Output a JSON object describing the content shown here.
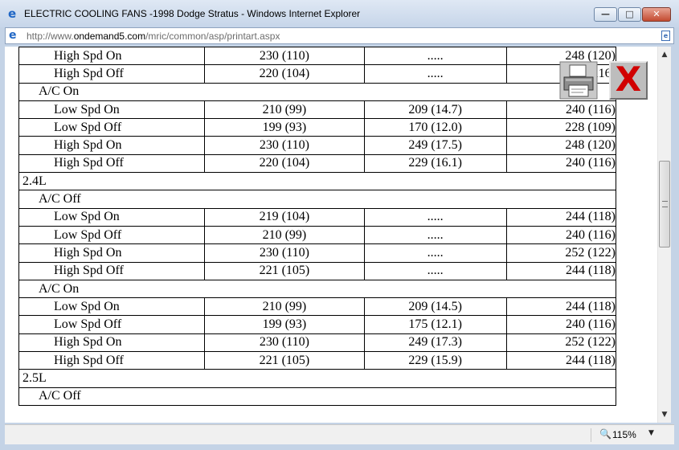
{
  "window": {
    "title": "ELECTRIC COOLING FANS -1998 Dodge Stratus - Windows Internet Explorer",
    "min_glyph": "—",
    "max_glyph": "□",
    "close_glyph": "✕"
  },
  "address": {
    "prefix": "http://www.",
    "domain": "ondemand5.com",
    "path": "/mric/common/asp/printart.aspx"
  },
  "overlay": {
    "close_glyph": "X"
  },
  "table": {
    "rows": [
      {
        "type": "data",
        "label": "High Spd On",
        "c2": "230 (110)",
        "c3": ".....",
        "c4": "248 (120)"
      },
      {
        "type": "data",
        "label": "High Spd Off",
        "c2": "220 (104)",
        "c3": ".....",
        "c4": "240 (116)"
      },
      {
        "type": "ac",
        "label": "A/C On"
      },
      {
        "type": "data",
        "label": "Low Spd On",
        "c2": "210 (99)",
        "c3": "209 (14.7)",
        "c4": "240 (116)"
      },
      {
        "type": "data",
        "label": "Low Spd Off",
        "c2": "199 (93)",
        "c3": "170 (12.0)",
        "c4": "228 (109)"
      },
      {
        "type": "data",
        "label": "High Spd On",
        "c2": "230 (110)",
        "c3": "249 (17.5)",
        "c4": "248 (120)"
      },
      {
        "type": "data",
        "label": "High Spd Off",
        "c2": "220 (104)",
        "c3": "229 (16.1)",
        "c4": "240 (116)"
      },
      {
        "type": "engine",
        "label": "2.4L"
      },
      {
        "type": "ac",
        "label": "A/C Off"
      },
      {
        "type": "data",
        "label": "Low Spd On",
        "c2": "219 (104)",
        "c3": ".....",
        "c4": "244 (118)"
      },
      {
        "type": "data",
        "label": "Low Spd Off",
        "c2": "210 (99)",
        "c3": ".....",
        "c4": "240 (116)"
      },
      {
        "type": "data",
        "label": "High Spd On",
        "c2": "230 (110)",
        "c3": ".....",
        "c4": "252 (122)"
      },
      {
        "type": "data",
        "label": "High Spd Off",
        "c2": "221 (105)",
        "c3": ".....",
        "c4": "244 (118)"
      },
      {
        "type": "ac",
        "label": "A/C On"
      },
      {
        "type": "data",
        "label": "Low Spd On",
        "c2": "210 (99)",
        "c3": "209 (14.5)",
        "c4": "244 (118)"
      },
      {
        "type": "data",
        "label": "Low Spd Off",
        "c2": "199 (93)",
        "c3": "175 (12.1)",
        "c4": "240 (116)"
      },
      {
        "type": "data",
        "label": "High Spd On",
        "c2": "230 (110)",
        "c3": "249 (17.3)",
        "c4": "252 (122)"
      },
      {
        "type": "data",
        "label": "High Spd Off",
        "c2": "221 (105)",
        "c3": "229 (15.9)",
        "c4": "244 (118)"
      },
      {
        "type": "engine",
        "label": "2.5L"
      },
      {
        "type": "ac",
        "label": "A/C Off"
      }
    ]
  },
  "statusbar": {
    "zoom": "115%",
    "zoom_dropdown_glyph": "▼"
  }
}
